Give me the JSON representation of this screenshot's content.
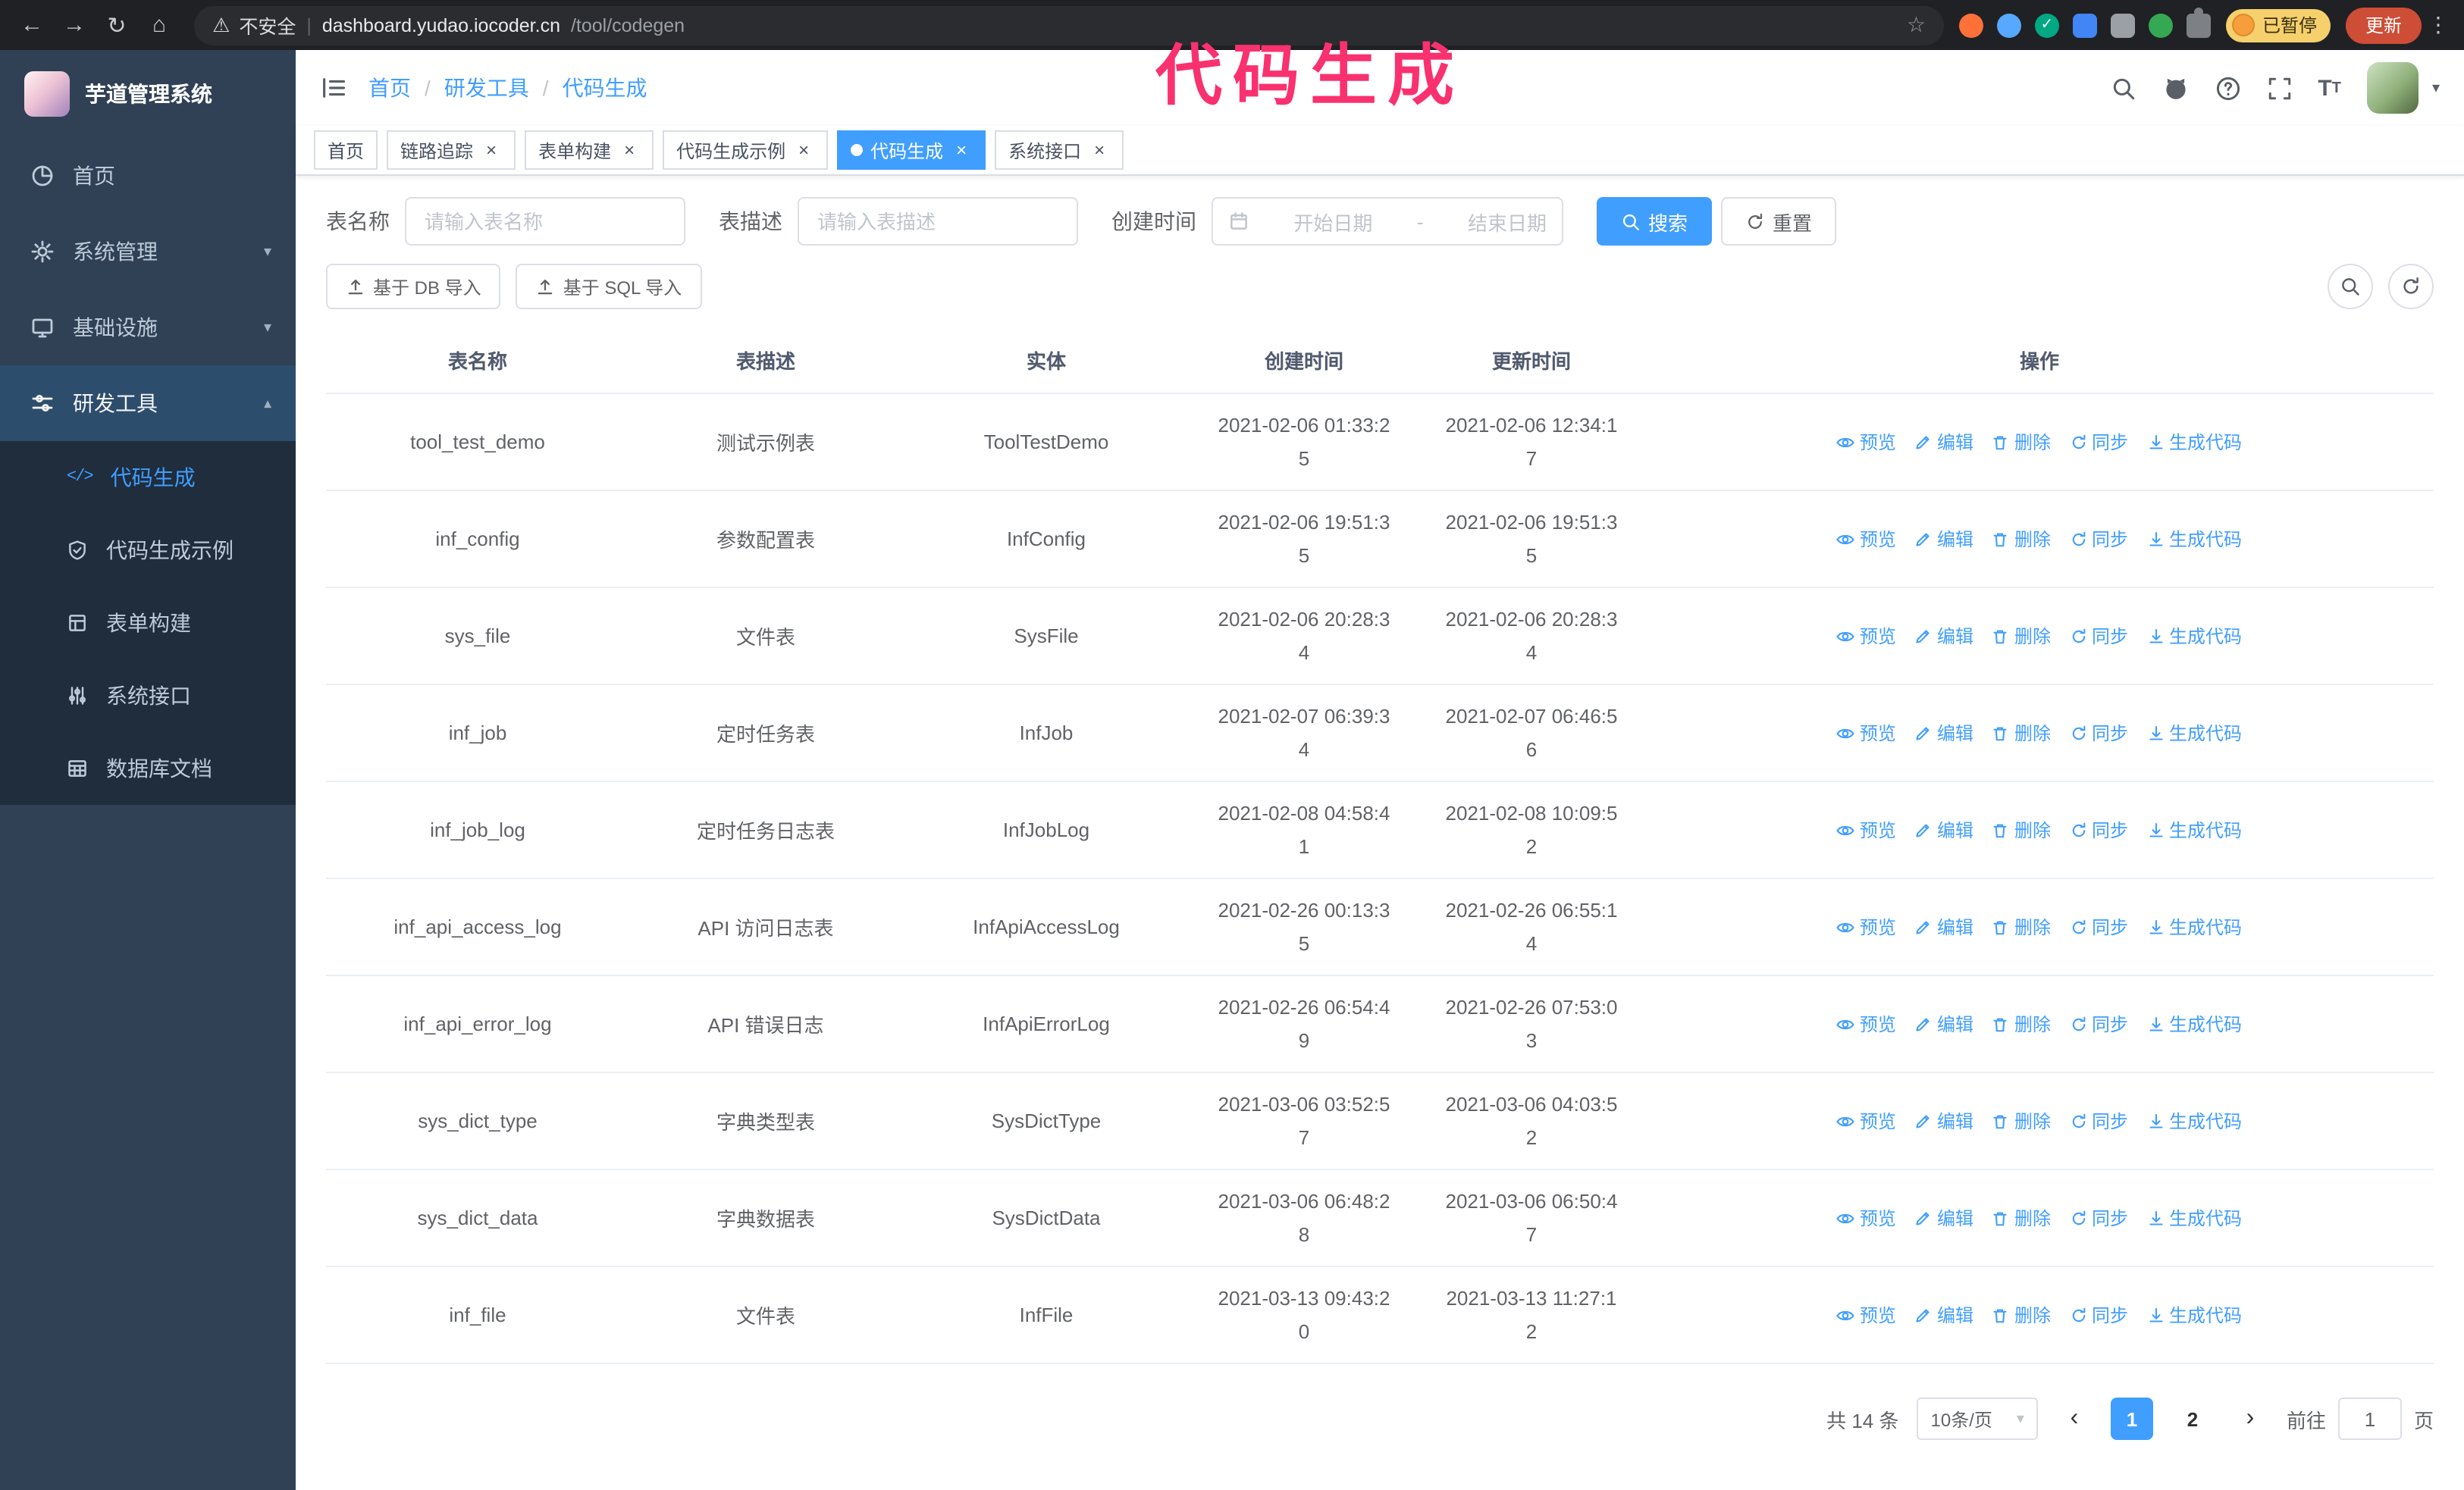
{
  "annotation": {
    "text": "代码生成"
  },
  "browser": {
    "security_label": "不安全",
    "url_host": "dashboard.yudao.iocoder.cn",
    "url_path": "/tool/codegen",
    "paused_badge": "已暂停",
    "update_button": "更新"
  },
  "sidebar": {
    "title": "芋道管理系统",
    "items": [
      {
        "label": "首页"
      },
      {
        "label": "系统管理"
      },
      {
        "label": "基础设施"
      },
      {
        "label": "研发工具"
      }
    ],
    "children": [
      {
        "label": "代码生成"
      },
      {
        "label": "代码生成示例"
      },
      {
        "label": "表单构建"
      },
      {
        "label": "系统接口"
      },
      {
        "label": "数据库文档"
      }
    ]
  },
  "breadcrumb": {
    "items": [
      "首页",
      "研发工具",
      "代码生成"
    ]
  },
  "tabs": [
    {
      "label": "首页"
    },
    {
      "label": "链路追踪"
    },
    {
      "label": "表单构建"
    },
    {
      "label": "代码生成示例"
    },
    {
      "label": "代码生成"
    },
    {
      "label": "系统接口"
    }
  ],
  "filters": {
    "table_name_label": "表名称",
    "table_name_placeholder": "请输入表名称",
    "table_desc_label": "表描述",
    "table_desc_placeholder": "请输入表描述",
    "create_time_label": "创建时间",
    "date_start": "开始日期",
    "date_sep": "-",
    "date_end": "结束日期",
    "search_button": "搜索",
    "reset_button": "重置"
  },
  "toolbar": {
    "import_db": "基于 DB 导入",
    "import_sql": "基于 SQL 导入"
  },
  "table": {
    "columns": [
      "表名称",
      "表描述",
      "实体",
      "创建时间",
      "更新时间",
      "操作"
    ],
    "actions": [
      "预览",
      "编辑",
      "删除",
      "同步",
      "生成代码"
    ],
    "rows": [
      {
        "name": "tool_test_demo",
        "desc": "测试示例表",
        "entity": "ToolTestDemo",
        "created": "2021-02-06 01:33:25",
        "updated": "2021-02-06 12:34:17"
      },
      {
        "name": "inf_config",
        "desc": "参数配置表",
        "entity": "InfConfig",
        "created": "2021-02-06 19:51:35",
        "updated": "2021-02-06 19:51:35"
      },
      {
        "name": "sys_file",
        "desc": "文件表",
        "entity": "SysFile",
        "created": "2021-02-06 20:28:34",
        "updated": "2021-02-06 20:28:34"
      },
      {
        "name": "inf_job",
        "desc": "定时任务表",
        "entity": "InfJob",
        "created": "2021-02-07 06:39:34",
        "updated": "2021-02-07 06:46:56"
      },
      {
        "name": "inf_job_log",
        "desc": "定时任务日志表",
        "entity": "InfJobLog",
        "created": "2021-02-08 04:58:41",
        "updated": "2021-02-08 10:09:52"
      },
      {
        "name": "inf_api_access_log",
        "desc": "API 访问日志表",
        "entity": "InfApiAccessLog",
        "created": "2021-02-26 00:13:35",
        "updated": "2021-02-26 06:55:14"
      },
      {
        "name": "inf_api_error_log",
        "desc": "API 错误日志",
        "entity": "InfApiErrorLog",
        "created": "2021-02-26 06:54:49",
        "updated": "2021-02-26 07:53:03"
      },
      {
        "name": "sys_dict_type",
        "desc": "字典类型表",
        "entity": "SysDictType",
        "created": "2021-03-06 03:52:57",
        "updated": "2021-03-06 04:03:52"
      },
      {
        "name": "sys_dict_data",
        "desc": "字典数据表",
        "entity": "SysDictData",
        "created": "2021-03-06 06:48:28",
        "updated": "2021-03-06 06:50:47"
      },
      {
        "name": "inf_file",
        "desc": "文件表",
        "entity": "InfFile",
        "created": "2021-03-13 09:43:20",
        "updated": "2021-03-13 11:27:12"
      }
    ]
  },
  "pagination": {
    "total": "共 14 条",
    "page_size": "10条/页",
    "pages": [
      "1",
      "2"
    ],
    "goto_label": "前往",
    "goto_value": "1",
    "goto_unit": "页"
  }
}
